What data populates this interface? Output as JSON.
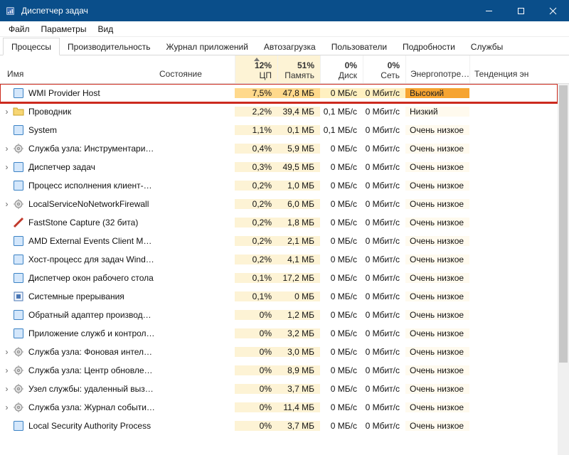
{
  "window": {
    "title": "Диспетчер задач"
  },
  "menu": {
    "file": "Файл",
    "options": "Параметры",
    "view": "Вид"
  },
  "tabs": [
    {
      "label": "Процессы",
      "active": true
    },
    {
      "label": "Производительность"
    },
    {
      "label": "Журнал приложений"
    },
    {
      "label": "Автозагрузка"
    },
    {
      "label": "Пользователи"
    },
    {
      "label": "Подробности"
    },
    {
      "label": "Службы"
    }
  ],
  "columns": {
    "name": "Имя",
    "status": "Состояние",
    "cpu": {
      "pct": "12%",
      "label": "ЦП"
    },
    "mem": {
      "pct": "51%",
      "label": "Память"
    },
    "disk": {
      "pct": "0%",
      "label": "Диск"
    },
    "net": {
      "pct": "0%",
      "label": "Сеть"
    },
    "energy": "Энергопотре…",
    "trend": "Тенденция эн"
  },
  "rows": [
    {
      "exp": false,
      "icon": "app",
      "name": "WMI Provider Host",
      "cpu": "7,5%",
      "mem": "47,8 МБ",
      "disk": "0 МБ/с",
      "net": "0 Мбит/с",
      "energy": "Высокий",
      "hl": true,
      "energyHigh": true
    },
    {
      "exp": true,
      "icon": "folder",
      "name": "Проводник",
      "cpu": "2,2%",
      "mem": "39,4 МБ",
      "disk": "0,1 МБ/с",
      "net": "0 Мбит/с",
      "energy": "Низкий"
    },
    {
      "exp": false,
      "icon": "app",
      "name": "System",
      "cpu": "1,1%",
      "mem": "0,1 МБ",
      "disk": "0,1 МБ/с",
      "net": "0 Мбит/с",
      "energy": "Очень низкое"
    },
    {
      "exp": true,
      "icon": "svc",
      "name": "Служба узла: Инструментари…",
      "cpu": "0,4%",
      "mem": "5,9 МБ",
      "disk": "0 МБ/с",
      "net": "0 Мбит/с",
      "energy": "Очень низкое"
    },
    {
      "exp": true,
      "icon": "app",
      "name": "Диспетчер задач",
      "cpu": "0,3%",
      "mem": "49,5 МБ",
      "disk": "0 МБ/с",
      "net": "0 Мбит/с",
      "energy": "Очень низкое"
    },
    {
      "exp": false,
      "icon": "app",
      "name": "Процесс исполнения клиент-…",
      "cpu": "0,2%",
      "mem": "1,0 МБ",
      "disk": "0 МБ/с",
      "net": "0 Мбит/с",
      "energy": "Очень низкое"
    },
    {
      "exp": true,
      "icon": "svc",
      "name": "LocalServiceNoNetworkFirewall",
      "cpu": "0,2%",
      "mem": "6,0 МБ",
      "disk": "0 МБ/с",
      "net": "0 Мбит/с",
      "energy": "Очень низкое"
    },
    {
      "exp": false,
      "icon": "fs",
      "name": "FastStone Capture (32 бита)",
      "cpu": "0,2%",
      "mem": "1,8 МБ",
      "disk": "0 МБ/с",
      "net": "0 Мбит/с",
      "energy": "Очень низкое"
    },
    {
      "exp": false,
      "icon": "app",
      "name": "AMD External Events Client Mo…",
      "cpu": "0,2%",
      "mem": "2,1 МБ",
      "disk": "0 МБ/с",
      "net": "0 Мбит/с",
      "energy": "Очень низкое"
    },
    {
      "exp": false,
      "icon": "app",
      "name": "Хост-процесс для задач Windo…",
      "cpu": "0,2%",
      "mem": "4,1 МБ",
      "disk": "0 МБ/с",
      "net": "0 Мбит/с",
      "energy": "Очень низкое"
    },
    {
      "exp": false,
      "icon": "app",
      "name": "Диспетчер окон рабочего стола",
      "cpu": "0,1%",
      "mem": "17,2 МБ",
      "disk": "0 МБ/с",
      "net": "0 Мбит/с",
      "energy": "Очень низкое"
    },
    {
      "exp": false,
      "icon": "sys",
      "name": "Системные прерывания",
      "cpu": "0,1%",
      "mem": "0 МБ",
      "disk": "0 МБ/с",
      "net": "0 Мбит/с",
      "energy": "Очень низкое"
    },
    {
      "exp": false,
      "icon": "app",
      "name": "Обратный адаптер производ…",
      "cpu": "0%",
      "mem": "1,2 МБ",
      "disk": "0 МБ/с",
      "net": "0 Мбит/с",
      "energy": "Очень низкое"
    },
    {
      "exp": false,
      "icon": "app",
      "name": "Приложение служб и контрол…",
      "cpu": "0%",
      "mem": "3,2 МБ",
      "disk": "0 МБ/с",
      "net": "0 Мбит/с",
      "energy": "Очень низкое"
    },
    {
      "exp": true,
      "icon": "svc",
      "name": "Служба узла: Фоновая интелл…",
      "cpu": "0%",
      "mem": "3,0 МБ",
      "disk": "0 МБ/с",
      "net": "0 Мбит/с",
      "energy": "Очень низкое"
    },
    {
      "exp": true,
      "icon": "svc",
      "name": "Служба узла: Центр обновлен…",
      "cpu": "0%",
      "mem": "8,9 МБ",
      "disk": "0 МБ/с",
      "net": "0 Мбит/с",
      "energy": "Очень низкое"
    },
    {
      "exp": true,
      "icon": "svc",
      "name": "Узел службы: удаленный выз…",
      "cpu": "0%",
      "mem": "3,7 МБ",
      "disk": "0 МБ/с",
      "net": "0 Мбит/с",
      "energy": "Очень низкое"
    },
    {
      "exp": true,
      "icon": "svc",
      "name": "Служба узла: Журнал событи…",
      "cpu": "0%",
      "mem": "11,4 МБ",
      "disk": "0 МБ/с",
      "net": "0 Мбит/с",
      "energy": "Очень низкое"
    },
    {
      "exp": false,
      "icon": "app",
      "name": "Local Security Authority Process",
      "cpu": "0%",
      "mem": "3,7 МБ",
      "disk": "0 МБ/с",
      "net": "0 Мбит/с",
      "energy": "Очень низкое"
    }
  ]
}
